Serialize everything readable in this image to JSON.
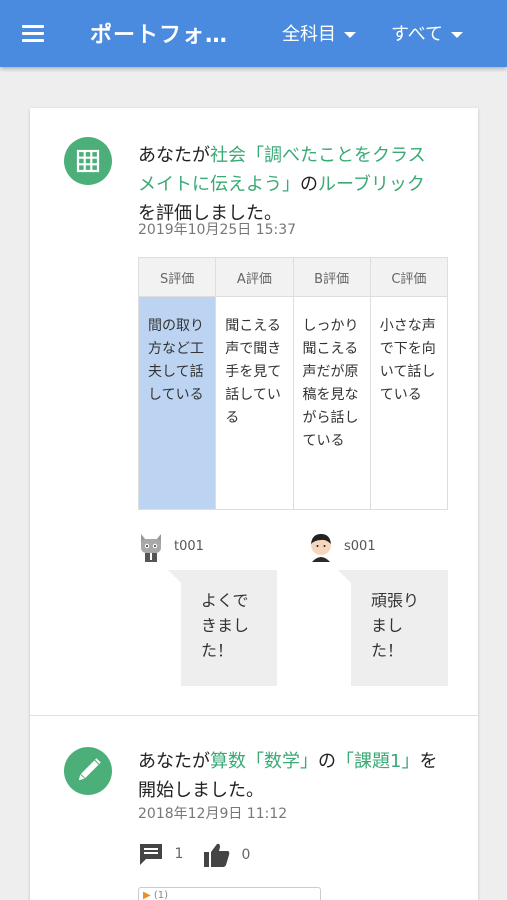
{
  "header": {
    "title": "ポートフォ…",
    "filter_subject": "全科目",
    "filter_scope": "すべて"
  },
  "feed": [
    {
      "text_pre": "あなたが",
      "subject": "社会",
      "assignment": "「調べたことをクラスメイトに伝えよう」",
      "text_mid": "の",
      "object": "ルーブリック",
      "text_post": "を評価しました。",
      "date": "2019年10月25日 15:37",
      "rubric": {
        "headers": [
          "S評価",
          "A評価",
          "B評価",
          "C評価"
        ],
        "cells": [
          "間の取り方など工夫して話している",
          "聞こえる声で聞き手を見て話している",
          "しっかり聞こえる声だが原稿を見ながら話している",
          "小さな声で下を向いて話している"
        ],
        "selected_index": 0
      },
      "comments": [
        {
          "user": "t001",
          "text": "よくできました！"
        },
        {
          "user": "s001",
          "text": "頑張りました！"
        }
      ]
    },
    {
      "text_pre": "あなたが",
      "subject": "算数",
      "assignment": "「数学」",
      "text_mid": "の",
      "object": "「課題1」",
      "text_post": "を開始しました。",
      "date": "2018年12月9日 11:12",
      "comment_count": "1",
      "like_count": "0",
      "attachment_label": "(1)"
    }
  ],
  "colors": {
    "appbar": "#4a8bdf",
    "accent_green": "#4caf7a",
    "link_green": "#3aaa75",
    "selected_cell": "#bcd4f2"
  },
  "icons": [
    "menu-icon",
    "caret-down-icon",
    "grid-icon",
    "pencil-icon",
    "comment-icon",
    "thumbs-up-icon"
  ]
}
